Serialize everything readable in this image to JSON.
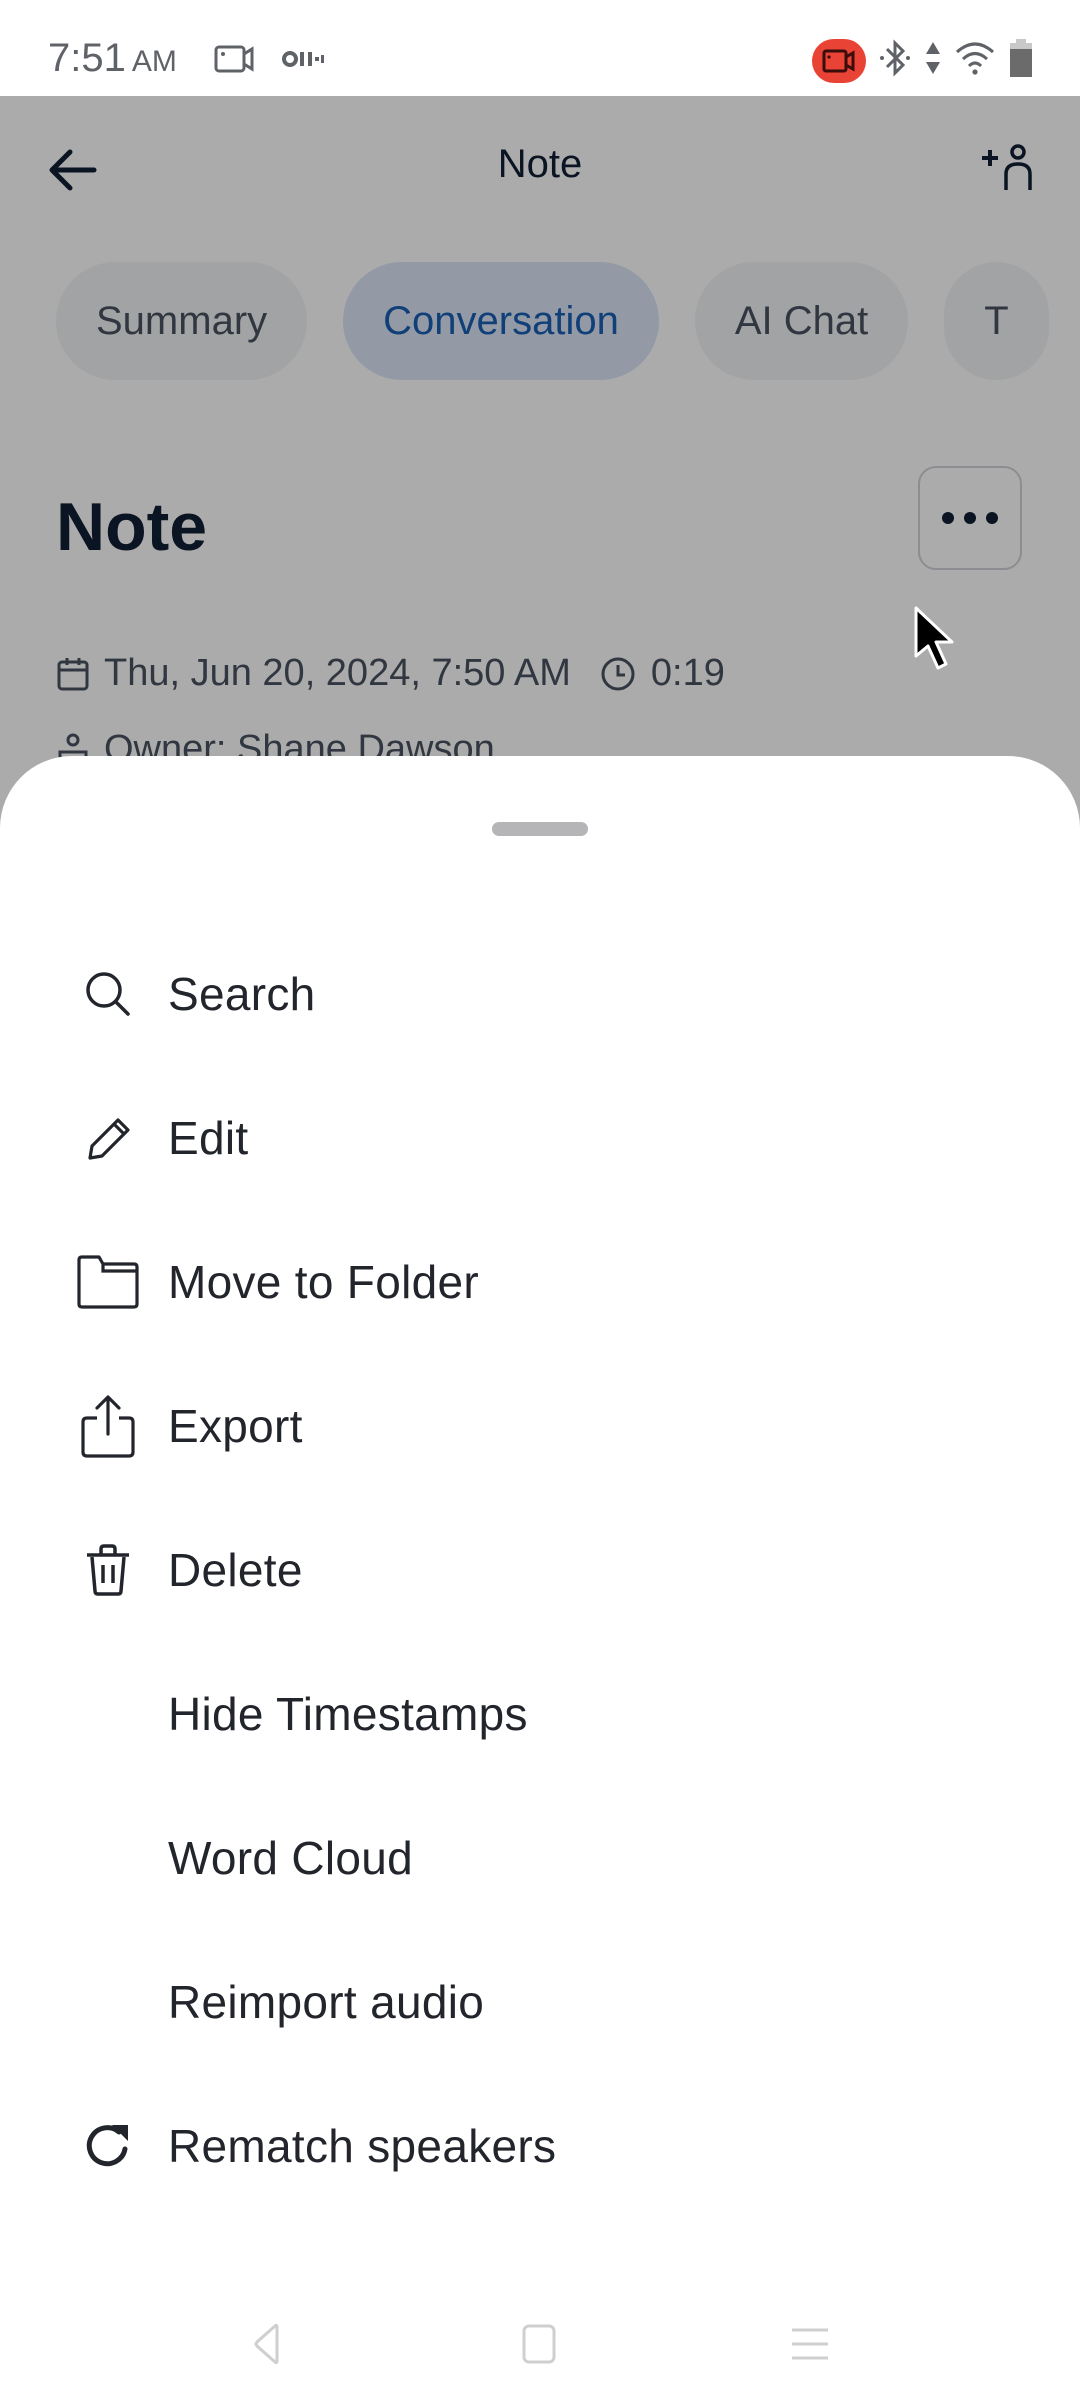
{
  "status_bar": {
    "time": "7:51",
    "ampm": "AM",
    "left_icons": [
      "screen-record-icon",
      "voicemail-icon"
    ],
    "right_icons": [
      "recording-indicator-icon",
      "bluetooth-icon",
      "data-arrows-icon",
      "wifi-icon",
      "battery-icon"
    ],
    "recording_color": "#e84335"
  },
  "header": {
    "title": "Note",
    "back_icon": "arrow-left-icon",
    "share_icon": "add-person-icon"
  },
  "tabs": [
    {
      "label": "Summary",
      "active": false
    },
    {
      "label": "Conversation",
      "active": true
    },
    {
      "label": "AI Chat",
      "active": false
    },
    {
      "label": "T",
      "active": false
    }
  ],
  "note": {
    "title": "Note",
    "date": "Thu, Jun 20, 2024, 7:50 AM",
    "duration": "0:19",
    "owner": "Owner: Shane Dawson",
    "more_icon": "more-horizontal-icon"
  },
  "sheet": {
    "items": [
      {
        "label": "Search",
        "icon": "search-icon"
      },
      {
        "label": "Edit",
        "icon": "pencil-icon"
      },
      {
        "label": "Move to Folder",
        "icon": "folder-icon"
      },
      {
        "label": "Export",
        "icon": "share-export-icon"
      },
      {
        "label": "Delete",
        "icon": "trash-icon"
      },
      {
        "label": "Hide Timestamps",
        "icon": ""
      },
      {
        "label": "Word Cloud",
        "icon": ""
      },
      {
        "label": "Reimport audio",
        "icon": ""
      },
      {
        "label": "Rematch speakers",
        "icon": "refresh-icon"
      }
    ]
  },
  "nav_bar": {
    "buttons": [
      "back-triangle-icon",
      "home-square-icon",
      "recents-menu-icon"
    ]
  },
  "colors": {
    "accent": "#1a5fb4",
    "active_tab_bg": "#dbe6f8",
    "title_text": "#0f1f33",
    "menu_text": "#22252b"
  }
}
